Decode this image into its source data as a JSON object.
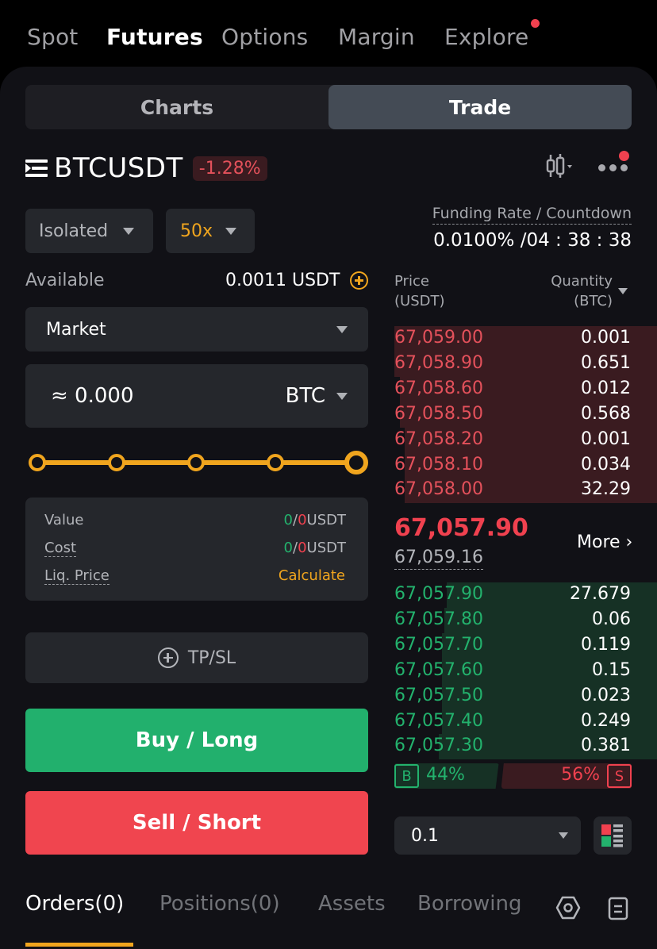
{
  "top_nav": {
    "items": [
      {
        "label": "Spot",
        "active": false
      },
      {
        "label": "Futures",
        "active": true
      },
      {
        "label": "Options",
        "active": false
      },
      {
        "label": "Margin",
        "active": false
      },
      {
        "label": "Explore",
        "active": false,
        "notification_dot": true
      }
    ]
  },
  "view_toggle": {
    "charts_label": "Charts",
    "trade_label": "Trade",
    "active": "Trade"
  },
  "symbol": {
    "name": "BTCUSDT",
    "change": "-1.28%",
    "menu_icon": "list-menu-icon",
    "chart_icon": "candlestick-icon",
    "more_icon": "more-dots-icon"
  },
  "margin_mode": {
    "value": "Isolated"
  },
  "leverage": {
    "value": "50x"
  },
  "funding": {
    "label": "Funding Rate / Countdown",
    "value": "0.0100% /04 : 38 : 38"
  },
  "available": {
    "label": "Available",
    "value": "0.0011 USDT"
  },
  "order_type": {
    "value": "Market"
  },
  "quantity": {
    "value": "≈ 0.000",
    "unit": "BTC"
  },
  "slider": {
    "percent": 100,
    "steps": [
      0,
      25,
      50,
      75,
      100
    ]
  },
  "summary": {
    "value_label": "Value",
    "value_buy": "0",
    "value_sep": "/",
    "value_sell": "0",
    "value_unit": "USDT",
    "cost_label": "Cost",
    "cost_buy": "0",
    "cost_sep": "/",
    "cost_sell": "0",
    "cost_unit": "USDT",
    "liq_label": "Liq. Price",
    "liq_action": "Calculate"
  },
  "tpsl": {
    "label": "TP/SL"
  },
  "buy_button": {
    "label": "Buy / Long"
  },
  "sell_button": {
    "label": "Sell / Short"
  },
  "orderbook": {
    "price_header_1": "Price",
    "price_header_2": "(USDT)",
    "qty_header_1": "Quantity",
    "qty_header_2": "(BTC)",
    "asks": [
      {
        "price": "67,059.00",
        "qty": "0.001",
        "depth": 1.0
      },
      {
        "price": "67,058.90",
        "qty": "0.651",
        "depth": 1.0
      },
      {
        "price": "67,058.60",
        "qty": "0.012",
        "depth": 0.98
      },
      {
        "price": "67,058.50",
        "qty": "0.568",
        "depth": 0.98
      },
      {
        "price": "67,058.20",
        "qty": "0.001",
        "depth": 0.96
      },
      {
        "price": "67,058.10",
        "qty": "0.034",
        "depth": 0.96
      },
      {
        "price": "67,058.00",
        "qty": "32.29",
        "depth": 0.96
      }
    ],
    "last_price": "67,057.90",
    "mark_price": "67,059.16",
    "more_label": "More",
    "bids": [
      {
        "price": "67,057.90",
        "qty": "27.679",
        "depth": 0.8
      },
      {
        "price": "67,057.80",
        "qty": "0.06",
        "depth": 0.81
      },
      {
        "price": "67,057.70",
        "qty": "0.119",
        "depth": 0.82
      },
      {
        "price": "67,057.60",
        "qty": "0.15",
        "depth": 0.82
      },
      {
        "price": "67,057.50",
        "qty": "0.023",
        "depth": 0.82
      },
      {
        "price": "67,057.40",
        "qty": "0.249",
        "depth": 0.82
      },
      {
        "price": "67,057.30",
        "qty": "0.381",
        "depth": 0.83
      }
    ],
    "buy_ratio_tag": "B",
    "buy_ratio": "44%",
    "sell_ratio": "56%",
    "sell_ratio_tag": "S",
    "buy_ratio_value": 44,
    "sell_ratio_value": 56,
    "depth_step": "0.1"
  },
  "bottom_tabs": {
    "items": [
      {
        "label": "Orders(0)",
        "active": true
      },
      {
        "label": "Positions(0)",
        "active": false
      },
      {
        "label": "Assets",
        "active": false
      },
      {
        "label": "Borrowing",
        "active": false
      }
    ],
    "settings_icon": "hexagon-settings-icon",
    "history_icon": "document-list-icon"
  },
  "colors": {
    "accent": "#f0a51e",
    "buy": "#23b26d",
    "sell": "#f0414f",
    "bg": "#111116",
    "card": "#25272c"
  }
}
